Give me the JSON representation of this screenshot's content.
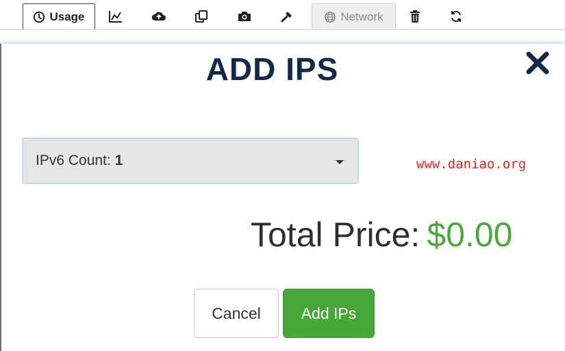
{
  "toolbar": {
    "tabs": [
      {
        "label": "Usage",
        "icon": "clock-icon"
      },
      {
        "label": "",
        "icon": "chart-line-icon"
      },
      {
        "label": "",
        "icon": "cloud-upload-icon"
      },
      {
        "label": "",
        "icon": "clone-icon"
      },
      {
        "label": "",
        "icon": "camera-icon"
      },
      {
        "label": "",
        "icon": "wrench-icon"
      },
      {
        "label": "Network",
        "icon": "globe-icon"
      },
      {
        "label": "",
        "icon": "trash-icon"
      },
      {
        "label": "",
        "icon": "refresh-icon"
      }
    ]
  },
  "modal": {
    "title": "ADD IPS",
    "close_icon": "close-icon",
    "select": {
      "label": "IPv6 Count:",
      "value": "1"
    },
    "total_label": "Total Price:",
    "total_value": "$0.00",
    "cancel_label": "Cancel",
    "add_label": "Add IPs"
  },
  "watermark": "www.daniao.org",
  "colors": {
    "title": "#14294a",
    "price_green": "#4aa83c",
    "add_button": "#47a83a",
    "select_bg": "#e6e6e6",
    "select_border": "#b9d9f4",
    "watermark": "#e02020"
  }
}
